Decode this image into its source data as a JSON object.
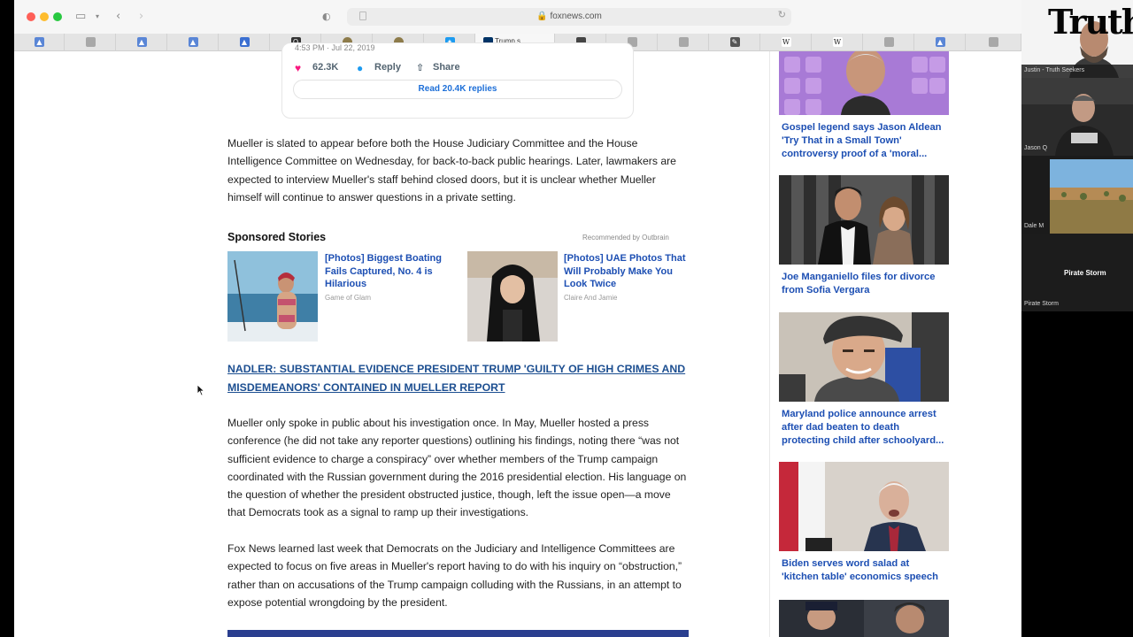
{
  "browser": {
    "url": "foxnews.com",
    "active_tab_title": "Trump s..."
  },
  "tweet": {
    "date": "4:53 PM · Jul 22, 2019",
    "likes": "62.3K",
    "reply_label": "Reply",
    "share_label": "Share",
    "read_replies": "Read 20.4K replies"
  },
  "article": {
    "paragraph1": "Mueller is slated to appear before both the House Judiciary Committee and the House Intelligence Committee on Wednesday, for back-to-back public hearings. Later, lawmakers are expected to interview Mueller's staff behind closed doors, but it is unclear whether Mueller himself will continue to answer questions in a private setting.",
    "related_link": "NADLER: SUBSTANTIAL EVIDENCE PRESIDENT TRUMP 'GUILTY OF HIGH CRIMES AND MISDEMEANORS' CONTAINED IN MUELLER REPORT",
    "paragraph2": "Mueller only spoke in public about his investigation once. In May, Mueller hosted a press conference (he did not take any reporter questions) outlining his findings, noting there “was not sufficient evidence to charge a conspiracy” over whether members of the Trump campaign coordinated with the Russian government during the 2016 presidential election. His language on the question of whether the president obstructed justice, though, left the issue open—a move that Democrats took as a signal to ramp up their investigations.",
    "paragraph3": "Fox News learned last week that Democrats on the Judiciary and Intelligence Committees are expected to focus on five areas in Mueller's report having to do with his inquiry on “obstruction,” rather than on accusations of the Trump campaign colluding with the Russians, in an attempt to expose potential wrongdoing by the president."
  },
  "sponsored": {
    "heading": "Sponsored Stories",
    "recommended_by": "Recommended by Outbrain",
    "items": [
      {
        "title": "[Photos] Biggest Boating Fails Captured, No. 4 is Hilarious",
        "source": "Game of Glam"
      },
      {
        "title": "[Photos] UAE Photos That Will Probably Make You Look Twice",
        "source": "Claire And Jamie"
      }
    ]
  },
  "sidebar": {
    "stories": [
      {
        "title": "Gospel legend says Jason Aldean 'Try That in a Small Town' controversy proof of a 'moral..."
      },
      {
        "title": "Joe Manganiello files for divorce from Sofia Vergara"
      },
      {
        "title": "Maryland police announce arrest after dad beaten to death protecting child after schoolyard..."
      },
      {
        "title": "Biden serves word salad at 'kitchen table' economics speech"
      }
    ]
  },
  "call": {
    "logo": "Truth",
    "participants": [
      {
        "name": "Justin - Truth Seekers"
      },
      {
        "name": "Jason Q"
      },
      {
        "name": "Dale M"
      },
      {
        "name": "Pirate Storm"
      }
    ],
    "pirate_storm_caption": "Pirate Storm"
  }
}
